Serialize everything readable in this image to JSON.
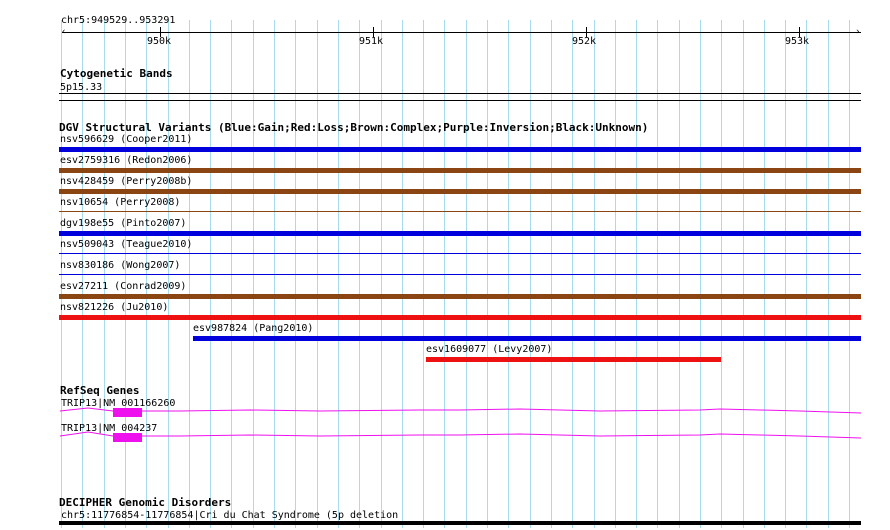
{
  "ruler": {
    "region": "chr5:949529..953291",
    "ticks": [
      "950k",
      "951k",
      "952k",
      "953k"
    ]
  },
  "cytoband": {
    "title": "Cytogenetic Bands",
    "band": "5p15.33"
  },
  "dgv": {
    "title": "DGV Structural Variants (Blue:Gain;Red:Loss;Brown:Complex;Purple:Inversion;Black:Unknown)",
    "colors": {
      "gain": "#0000dd",
      "loss": "#ee1111",
      "complex": "#8b4513"
    },
    "variants": [
      {
        "label": "nsv596629 (Cooper2011)",
        "type": "gain"
      },
      {
        "label": "esv2759316 (Redon2006)",
        "type": "complex"
      },
      {
        "label": "nsv428459 (Perry2008b)",
        "type": "complex"
      },
      {
        "label": "nsv10654 (Perry2008)",
        "type": "complex"
      },
      {
        "label": "dgv198e55 (Pinto2007)",
        "type": "gain"
      },
      {
        "label": "nsv509043 (Teague2010)",
        "type": "gain"
      },
      {
        "label": "nsv830186 (Wong2007)",
        "type": "gain"
      },
      {
        "label": "esv27211 (Conrad2009)",
        "type": "complex"
      },
      {
        "label": "nsv821226 (Ju2010)",
        "type": "loss"
      },
      {
        "label": "esv987824 (Pang2010)",
        "type": "gain"
      },
      {
        "label": "esv1609077 (Levy2007)",
        "type": "loss"
      }
    ]
  },
  "refseq": {
    "title": "RefSeq Genes",
    "color": "#ee11ee",
    "genes": [
      {
        "label": "TRIP13|NM_001166260"
      },
      {
        "label": "TRIP13|NM_004237"
      }
    ]
  },
  "decipher": {
    "title": "DECIPHER Genomic Disorders",
    "entry": "chr5:11776854-11776854|Cri du Chat Syndrome (5p deletion"
  },
  "colors": {
    "gridline": "#a8dcec"
  }
}
